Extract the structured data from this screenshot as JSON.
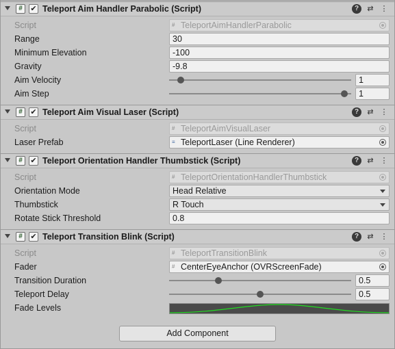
{
  "components": [
    {
      "title": "Teleport Aim Handler Parabolic (Script)",
      "script_label": "Script",
      "script_value": "TeleportAimHandlerParabolic",
      "fields": [
        {
          "label": "Range",
          "value": "30"
        },
        {
          "label": "Minimum Elevation",
          "value": "-100"
        },
        {
          "label": "Gravity",
          "value": "-9.8"
        }
      ],
      "sliders": [
        {
          "label": "Aim Velocity",
          "value": "1",
          "fraction": 0.03
        },
        {
          "label": "Aim Step",
          "value": "1",
          "fraction": 1.0
        }
      ]
    },
    {
      "title": "Teleport Aim Visual Laser (Script)",
      "script_label": "Script",
      "script_value": "TeleportAimVisualLaser",
      "object_fields": [
        {
          "label": "Laser Prefab",
          "value": "TeleportLaser (Line Renderer)"
        }
      ]
    },
    {
      "title": "Teleport Orientation Handler Thumbstick (Script)",
      "script_label": "Script",
      "script_value": "TeleportOrientationHandlerThumbstick",
      "dropdowns": [
        {
          "label": "Orientation Mode",
          "value": "Head Relative"
        },
        {
          "label": "Thumbstick",
          "value": "R Touch"
        }
      ],
      "fields": [
        {
          "label": "Rotate Stick Threshold",
          "value": "0.8"
        }
      ]
    },
    {
      "title": "Teleport Transition Blink (Script)",
      "script_label": "Script",
      "script_value": "TeleportTransitionBlink",
      "object_fields": [
        {
          "label": "Fader",
          "value": "CenterEyeAnchor (OVRScreenFade)"
        }
      ],
      "sliders": [
        {
          "label": "Transition Duration",
          "value": "0.5",
          "fraction": 0.25
        },
        {
          "label": "Teleport Delay",
          "value": "0.5",
          "fraction": 0.5
        }
      ],
      "curve_label": "Fade Levels"
    }
  ],
  "add_component_label": "Add Component",
  "icons": {
    "script": "script-icon",
    "enabled": "checkbox-icon",
    "help": "help-icon",
    "presets": "presets-icon",
    "menu": "kebab-menu-icon",
    "fold": "foldout-triangle-icon",
    "object_picker": "object-picker-icon"
  },
  "colors": {
    "curve_line": "#22dd22",
    "curve_bg": "#4a4a4a"
  }
}
